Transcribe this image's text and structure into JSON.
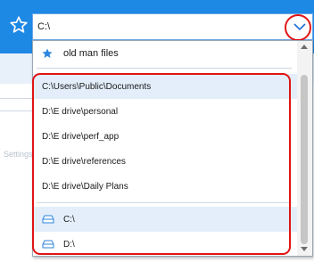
{
  "address": {
    "value": "C:\\"
  },
  "favorites": [
    {
      "label": "old man files",
      "icon": "star-icon"
    }
  ],
  "recent_paths": [
    "C:\\Users\\Public\\Documents",
    "D:\\E drive\\personal",
    "D:\\E drive\\perf_app",
    "D:\\E drive\\references",
    "D:\\E drive\\Daily Plans"
  ],
  "drives": [
    {
      "label": "C:\\"
    },
    {
      "label": "D:\\"
    }
  ],
  "colors": {
    "header": "#1e88e5",
    "star": "#2e86de",
    "highlight": "#e3eefa",
    "annotation": "#e01414"
  }
}
